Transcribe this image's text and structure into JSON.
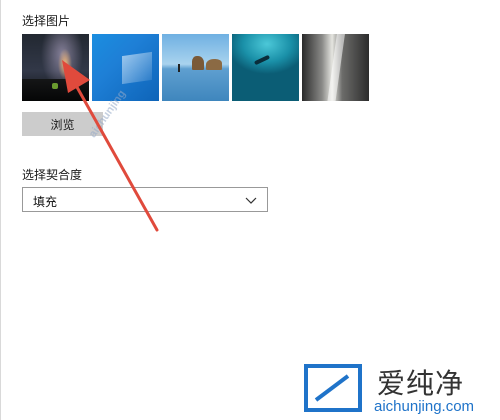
{
  "background": {
    "section_label": "选择图片",
    "browse_label": "浏览",
    "thumbnails": [
      {
        "name": "night-sky-thumbnail"
      },
      {
        "name": "windows-blue-thumbnail"
      },
      {
        "name": "beach-rocks-thumbnail"
      },
      {
        "name": "underwater-diver-thumbnail"
      },
      {
        "name": "rock-waterfall-thumbnail"
      }
    ]
  },
  "fit": {
    "label": "选择契合度",
    "value": "填充"
  },
  "watermark": {
    "brand_cn": "爱纯净",
    "url": "aichunjing.com",
    "diagonal": "aichunjing"
  },
  "colors": {
    "accent_arrow": "#e04a3c",
    "brand_blue": "#1f73c9"
  }
}
